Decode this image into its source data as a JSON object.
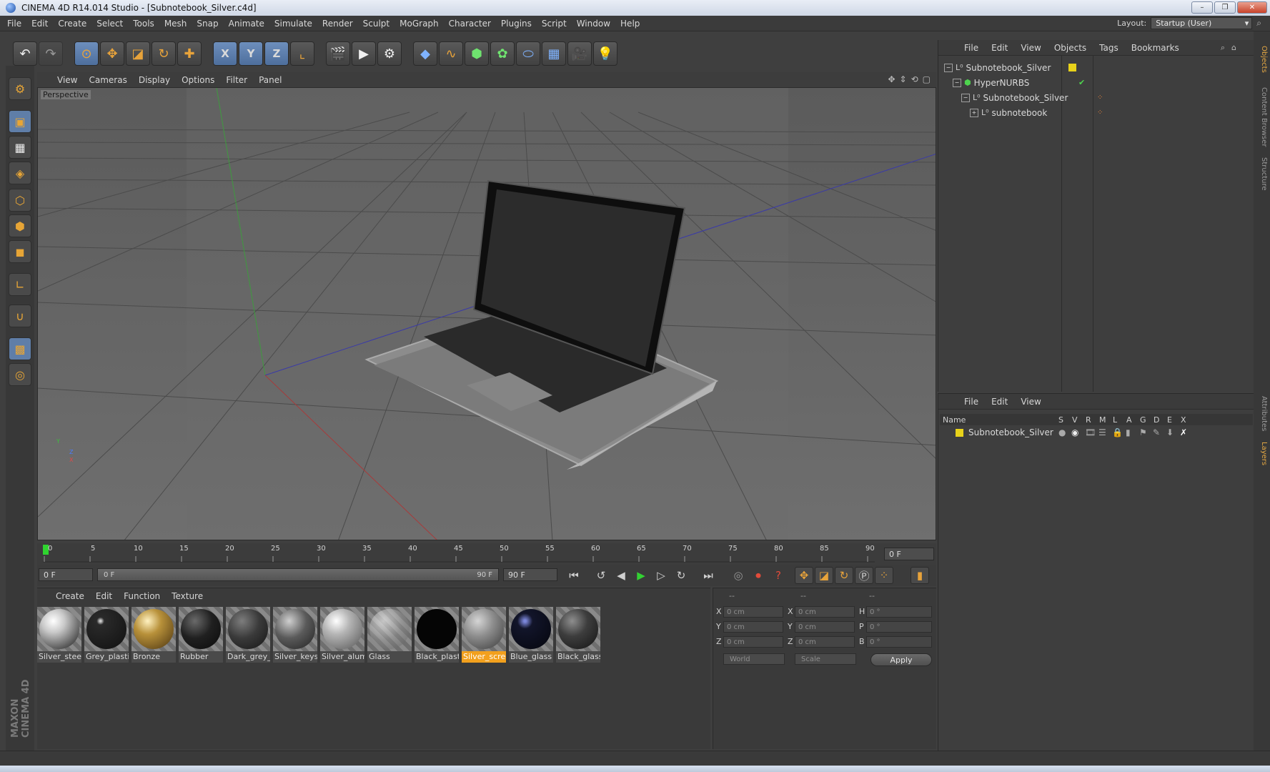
{
  "window": {
    "title": "CINEMA 4D R14.014 Studio - [Subnotebook_Silver.c4d]",
    "min": "–",
    "max": "❐",
    "close": "✕"
  },
  "menubar": {
    "items": [
      "File",
      "Edit",
      "Create",
      "Select",
      "Tools",
      "Mesh",
      "Snap",
      "Animate",
      "Simulate",
      "Render",
      "Sculpt",
      "MoGraph",
      "Character",
      "Plugins",
      "Script",
      "Window",
      "Help"
    ],
    "layout_label": "Layout:",
    "layout_value": "Startup (User)"
  },
  "icons": {
    "undo": "undo-icon",
    "redo": "redo-icon",
    "live_select": "live-select-icon",
    "move": "move-icon",
    "scale": "scale-icon",
    "rotate": "rotate-icon",
    "axis_x": "x-axis-icon",
    "axis_y": "y-axis-icon",
    "axis_z": "z-axis-icon"
  },
  "toolbar": {
    "x": "X",
    "y": "Y",
    "z": "Z"
  },
  "viewport": {
    "menu": [
      "View",
      "Cameras",
      "Display",
      "Options",
      "Filter",
      "Panel"
    ],
    "label": "Perspective",
    "axis_y": "Y",
    "axis_z": "Z",
    "axis_x": "X"
  },
  "timeline": {
    "ticks": [
      "0",
      "5",
      "10",
      "15",
      "20",
      "25",
      "30",
      "35",
      "40",
      "45",
      "50",
      "55",
      "60",
      "65",
      "70",
      "75",
      "80",
      "85",
      "90"
    ],
    "current_frame": "0 F"
  },
  "transport": {
    "start_field": "0 F",
    "range_start": "0 F",
    "range_end": "90 F",
    "end_field": "90 F"
  },
  "materials": {
    "menu": [
      "Create",
      "Edit",
      "Function",
      "Texture"
    ],
    "items": [
      {
        "name": "Silver_steel",
        "color": "#c9c9c9"
      },
      {
        "name": "Grey_plasti",
        "color": "#2a2a2a"
      },
      {
        "name": "Bronze",
        "color": "#b8913a"
      },
      {
        "name": "Rubber",
        "color": "#202020"
      },
      {
        "name": "Dark_grey_",
        "color": "#3a3a3a"
      },
      {
        "name": "Silver_keys",
        "color": "#5a5a5a"
      },
      {
        "name": "Silver_alum",
        "color": "#b5b5b5"
      },
      {
        "name": "Glass",
        "color": "#9c9c9c"
      },
      {
        "name": "Black_plast",
        "color": "#050505"
      },
      {
        "name": "Silver_scree",
        "color": "#8e8e8e"
      },
      {
        "name": "Blue_glass",
        "color": "#12152a"
      },
      {
        "name": "Black_glass",
        "color": "#3d3d3d"
      }
    ],
    "selected_index": 9
  },
  "coords": {
    "head_pos": "--",
    "head_size": "--",
    "head_rot": "--",
    "labels": {
      "x": "X",
      "y": "Y",
      "z": "Z",
      "h": "H",
      "p": "P",
      "b": "B"
    },
    "pos": {
      "x": "0 cm",
      "y": "0 cm",
      "z": "0 cm"
    },
    "size": {
      "x": "0 cm",
      "y": "0 cm",
      "z": "0 cm"
    },
    "rot": {
      "h": "0 °",
      "p": "0 °",
      "b": "0 °"
    },
    "mode1": "World",
    "mode2": "Scale",
    "apply": "Apply"
  },
  "objects": {
    "menu": [
      "File",
      "Edit",
      "View",
      "Objects",
      "Tags",
      "Bookmarks"
    ],
    "items": [
      {
        "name": "Subnotebook_Silver",
        "indent": 0
      },
      {
        "name": "HyperNURBS",
        "indent": 1
      },
      {
        "name": "Subnotebook_Silver",
        "indent": 2
      },
      {
        "name": "subnotebook",
        "indent": 3
      }
    ]
  },
  "layers": {
    "menu": [
      "File",
      "Edit",
      "View"
    ],
    "columns": [
      "Name",
      "S",
      "V",
      "R",
      "M",
      "L",
      "A",
      "G",
      "D",
      "E",
      "X"
    ],
    "row_name": "Subnotebook_Silver",
    "row_color": "#e8d21a"
  },
  "sidetabs": [
    "Objects",
    "Content Browser",
    "Structure",
    "Attributes",
    "Layers"
  ],
  "logo": "MAXON CINEMA 4D"
}
